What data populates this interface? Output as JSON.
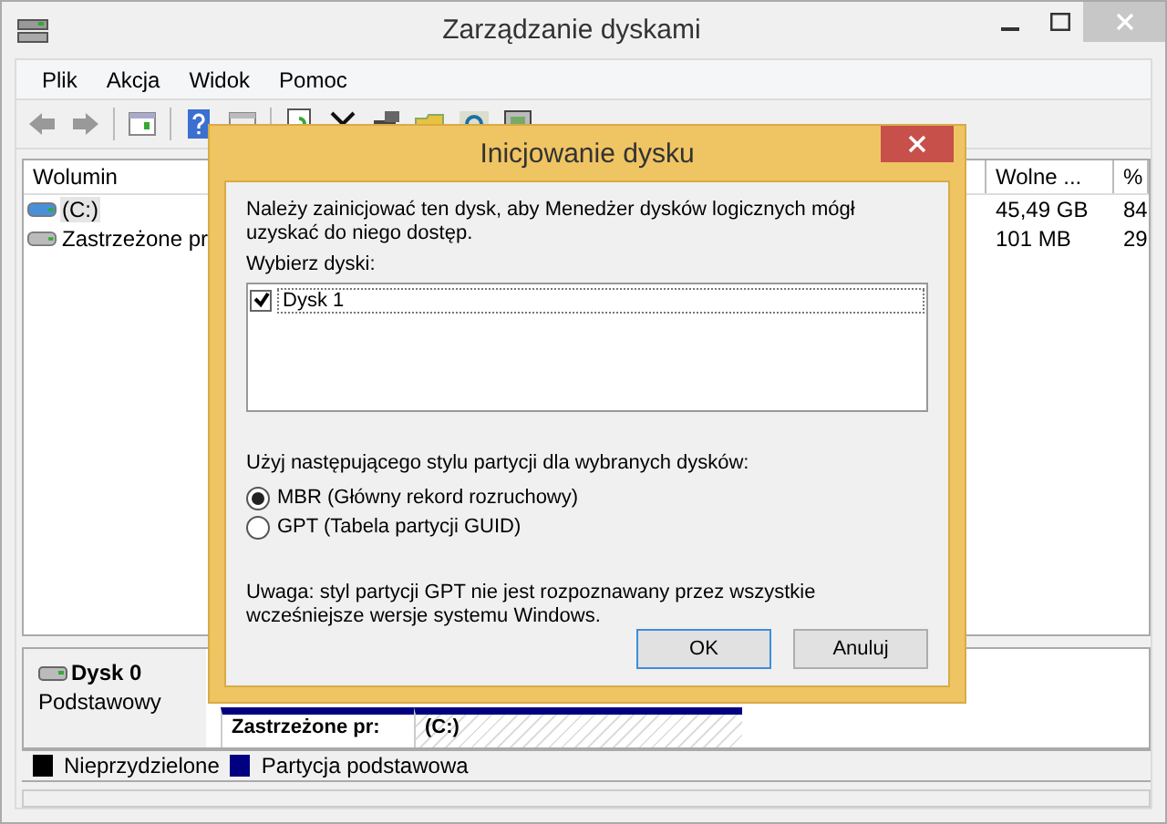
{
  "window": {
    "title": "Zarządzanie dyskami"
  },
  "menu": [
    "Plik",
    "Akcja",
    "Widok",
    "Pomoc"
  ],
  "volume_table": {
    "columns": [
      "Wolumin",
      "Wolne ...",
      "%"
    ],
    "rows": [
      {
        "cells": [
          "(C:)",
          "45,49 GB",
          "84"
        ],
        "selected": true
      },
      {
        "cells": [
          "Zastrzeżone pr",
          "101 MB",
          "29"
        ],
        "selected": false
      }
    ]
  },
  "disk_pane": {
    "name": "Dysk 0",
    "type": "Podstawowy",
    "partitions": [
      "Zastrzeżone pr:",
      "(C:)"
    ]
  },
  "legend": [
    {
      "label": "Nieprzydzielone",
      "color": "#000000"
    },
    {
      "label": "Partycja podstawowa",
      "color": "#000080"
    }
  ],
  "dialog": {
    "title": "Inicjowanie dysku",
    "intro": "Należy zainicjować ten dysk, aby Menedżer dysków logicznych mógł uzyskać do niego dostęp.",
    "disks_label": "Wybierz dyski:",
    "disks": [
      {
        "label": "Dysk 1",
        "checked": true
      }
    ],
    "style_label": "Użyj następującego stylu partycji dla wybranych dysków:",
    "styles": [
      {
        "label": "MBR (Główny rekord rozruchowy)",
        "selected": true
      },
      {
        "label": "GPT (Tabela partycji GUID)",
        "selected": false
      }
    ],
    "note": "Uwaga: styl partycji GPT nie jest rozpoznawany przez wszystkie wcześniejsze wersje systemu Windows.",
    "buttons": [
      {
        "label": "OK",
        "default": true
      },
      {
        "label": "Anuluj",
        "default": false
      }
    ]
  }
}
